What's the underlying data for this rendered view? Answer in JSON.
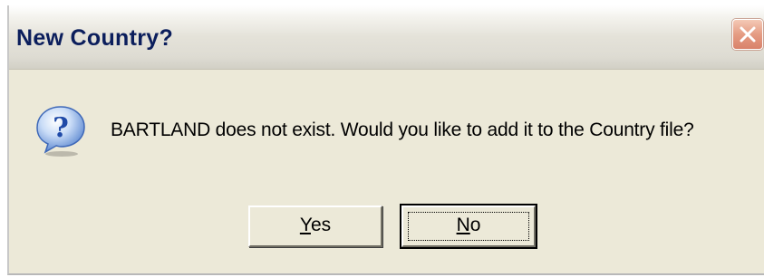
{
  "window": {
    "title": "New Country?"
  },
  "message": {
    "text": "BARTLAND does not exist. Would you like to add it to the Country file?",
    "icon": "question-icon"
  },
  "buttons": {
    "yes": {
      "mnemonic": "Y",
      "rest": "es"
    },
    "no": {
      "mnemonic": "N",
      "rest": "o"
    }
  },
  "colors": {
    "dialog_bg": "#ece9d8",
    "title_text": "#0b1e5c",
    "close_button": "#e59c83",
    "icon_blue": "#2b64c9"
  }
}
